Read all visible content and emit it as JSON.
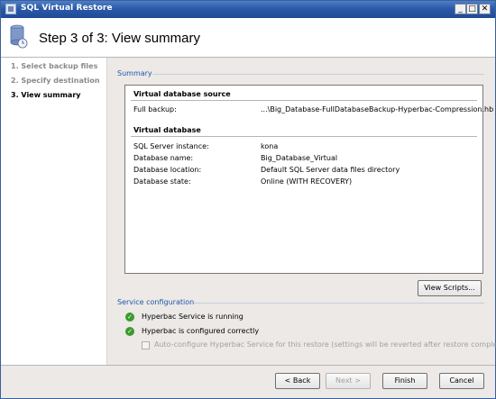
{
  "window": {
    "title": "SQL Virtual Restore",
    "min_glyph": "_",
    "max_glyph": "□",
    "close_glyph": "✕"
  },
  "header": {
    "step_title": "Step 3 of 3: View summary"
  },
  "sidebar": {
    "steps": [
      {
        "label": "1. Select backup files"
      },
      {
        "label": "2. Specify destination"
      },
      {
        "label": "3. View summary"
      }
    ]
  },
  "summary": {
    "section_label": "Summary",
    "source": {
      "title": "Virtual database source",
      "full_backup_label": "Full backup:",
      "full_backup_value": "...\\Big_Database-FullDatabaseBackup-Hyperbac-Compression.hb"
    },
    "virtual_db": {
      "title": "Virtual database",
      "rows": [
        {
          "label": "SQL Server instance:",
          "value": "kona"
        },
        {
          "label": "Database name:",
          "value": "Big_Database_Virtual"
        },
        {
          "label": "Database location:",
          "value": "Default SQL Server data files directory"
        },
        {
          "label": "Database state:",
          "value": "Online (WITH RECOVERY)"
        }
      ]
    },
    "view_scripts_label": "View Scripts..."
  },
  "service": {
    "section_label": "Service configuration",
    "statuses": [
      {
        "text": "Hyperbac Service is running"
      },
      {
        "text": "Hyperbac is configured correctly"
      }
    ],
    "autoconfig_label": "Auto-configure Hyperbac Service for this restore (settings will be reverted after restore completes)",
    "check_glyph": "✓"
  },
  "footer": {
    "back_label": "< Back",
    "next_label": "Next >",
    "finish_label": "Finish",
    "cancel_label": "Cancel"
  },
  "colors": {
    "title_bar": "#2c5aa8",
    "section_label": "#1f57a8",
    "check_green": "#3b9a2f"
  },
  "icons": {
    "app": "restore-app-icon",
    "header": "database-clock-icon",
    "status": "check-circle-icon"
  }
}
